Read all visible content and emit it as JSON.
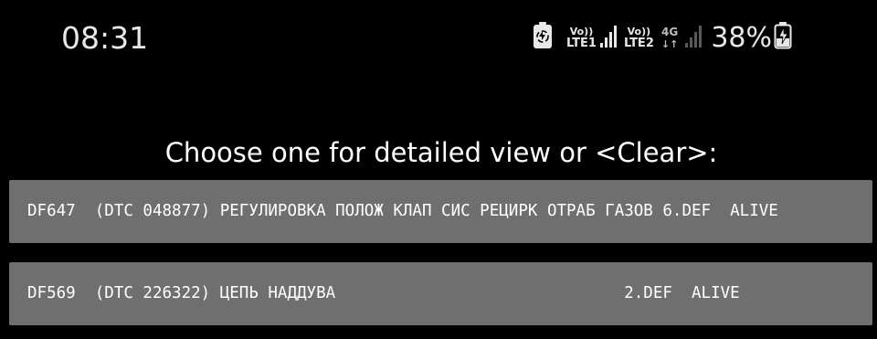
{
  "status_bar": {
    "time": "08:31",
    "sim1": {
      "top": "Vo))",
      "bottom": "LTE1"
    },
    "sim2": {
      "top": "Vo))",
      "bottom": "LTE2"
    },
    "network": {
      "top": "4G",
      "bottom": "↓↑"
    },
    "battery_percent": "38%",
    "icons": [
      "battery-saver-icon",
      "signal-icon",
      "signal-icon",
      "signal-icon",
      "charging-battery-icon"
    ]
  },
  "dialog": {
    "title": "Choose one for detailed view or <Clear>:"
  },
  "items": [
    {
      "text": "DF647  (DTC 048877) РЕГУЛИРОВКА ПОЛОЖ КЛАП СИС РЕЦИРК ОТРАБ ГАЗОВ 6.DEF  ALIVE"
    },
    {
      "text": "DF569  (DTC 226322) ЦЕПЬ НАДДУВА                              2.DEF  ALIVE"
    }
  ]
}
